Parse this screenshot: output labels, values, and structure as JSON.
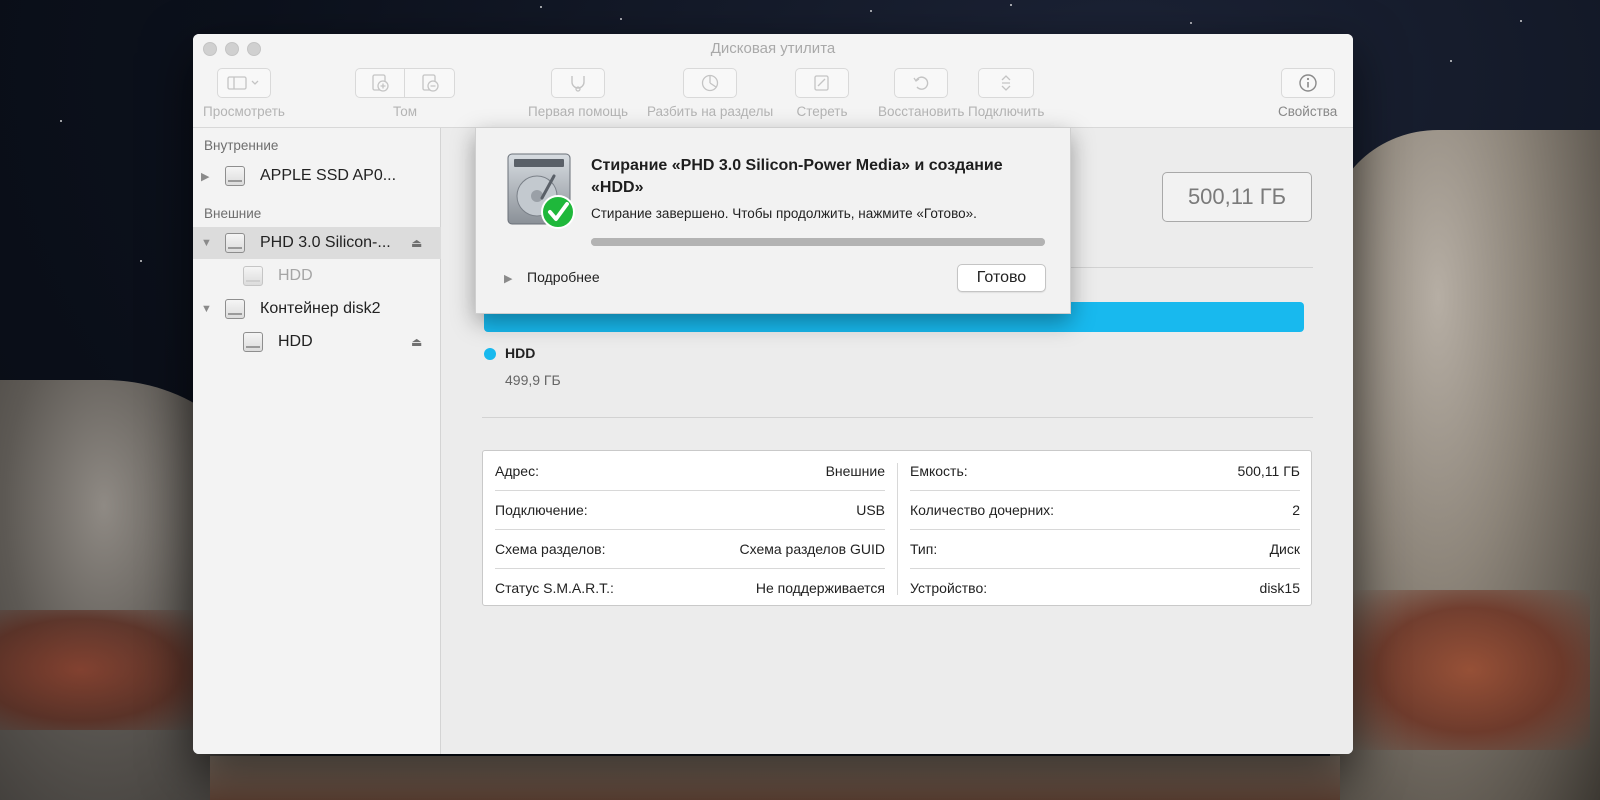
{
  "window": {
    "title": "Дисковая утилита"
  },
  "toolbar": {
    "view_label": "Просмотреть",
    "volume_label": "Том",
    "first_aid_label": "Первая помощь",
    "partition_label": "Разбить на разделы",
    "erase_label": "Стереть",
    "restore_label": "Восстановить",
    "mount_label": "Подключить",
    "info_label": "Свойства"
  },
  "sidebar": {
    "internal_heading": "Внутренние",
    "external_heading": "Внешние",
    "items": [
      {
        "label": "APPLE SSD AP0...",
        "icon": "internal-disk-icon"
      },
      {
        "label": "PHD 3.0 Silicon-...",
        "icon": "external-disk-icon",
        "selected": true
      },
      {
        "label": "HDD",
        "icon": "volume-icon",
        "dimmed": true
      },
      {
        "label": "Контейнер disk2",
        "icon": "container-icon"
      },
      {
        "label": "HDD",
        "icon": "volume-icon"
      }
    ]
  },
  "main": {
    "capacity": "500,11 ГБ",
    "usage": {
      "color": "#18b9ee",
      "name": "HDD",
      "size": "499,9 ГБ"
    },
    "info": {
      "left": [
        {
          "key": "Адрес:",
          "value": "Внешние"
        },
        {
          "key": "Подключение:",
          "value": "USB"
        },
        {
          "key": "Схема разделов:",
          "value": "Схема разделов GUID"
        },
        {
          "key": "Статус S.M.A.R.T.:",
          "value": "Не поддерживается"
        }
      ],
      "right": [
        {
          "key": "Емкость:",
          "value": "500,11 ГБ"
        },
        {
          "key": "Количество дочерних:",
          "value": "2"
        },
        {
          "key": "Тип:",
          "value": "Диск"
        },
        {
          "key": "Устройство:",
          "value": "disk15"
        }
      ]
    }
  },
  "sheet": {
    "title": "Стирание «PHD 3.0 Silicon-Power Media» и создание «HDD»",
    "message": "Стирание завершено. Чтобы продолжить, нажмите «Готово».",
    "progress": 1.0,
    "details_label": "Подробнее",
    "done_label": "Готово"
  },
  "colors": {
    "accent": "#18b9ee",
    "success": "#1fb83b"
  }
}
